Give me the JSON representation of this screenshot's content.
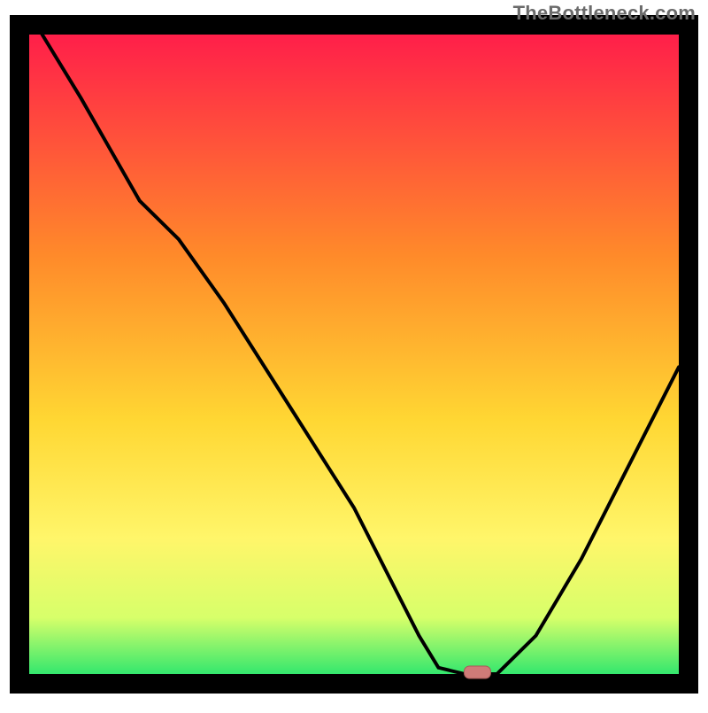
{
  "watermark": "TheBottleneck.com",
  "colors": {
    "frame": "#000000",
    "curve": "#000000",
    "marker_fill": "#cf7b78",
    "marker_stroke": "#a85a58",
    "gradient_top": "#ff1a4b",
    "gradient_mid1": "#ff8a2a",
    "gradient_mid2": "#ffd733",
    "gradient_mid3": "#fff66a",
    "gradient_mid4": "#d7ff6a",
    "gradient_bottom": "#17e36e"
  },
  "chart_data": {
    "type": "line",
    "title": "",
    "xlabel": "",
    "ylabel": "",
    "xlim": [
      0,
      100
    ],
    "ylim": [
      0,
      100
    ],
    "x": [
      2,
      8,
      17,
      23,
      30,
      40,
      50,
      55,
      60,
      63,
      67,
      72,
      78,
      85,
      92,
      100
    ],
    "values": [
      100,
      90,
      74,
      68,
      58,
      42,
      26,
      16,
      6,
      1,
      0,
      0,
      6,
      18,
      32,
      48
    ],
    "marker": {
      "x": 69,
      "y": 0,
      "shape": "rounded-rect"
    },
    "background": {
      "type": "vertical-gradient",
      "stops": [
        {
          "pos": 0.0,
          "color": "#ff1a4b"
        },
        {
          "pos": 0.35,
          "color": "#ff8a2a"
        },
        {
          "pos": 0.6,
          "color": "#ffd733"
        },
        {
          "pos": 0.78,
          "color": "#fff66a"
        },
        {
          "pos": 0.9,
          "color": "#d7ff6a"
        },
        {
          "pos": 1.0,
          "color": "#17e36e"
        }
      ]
    }
  }
}
